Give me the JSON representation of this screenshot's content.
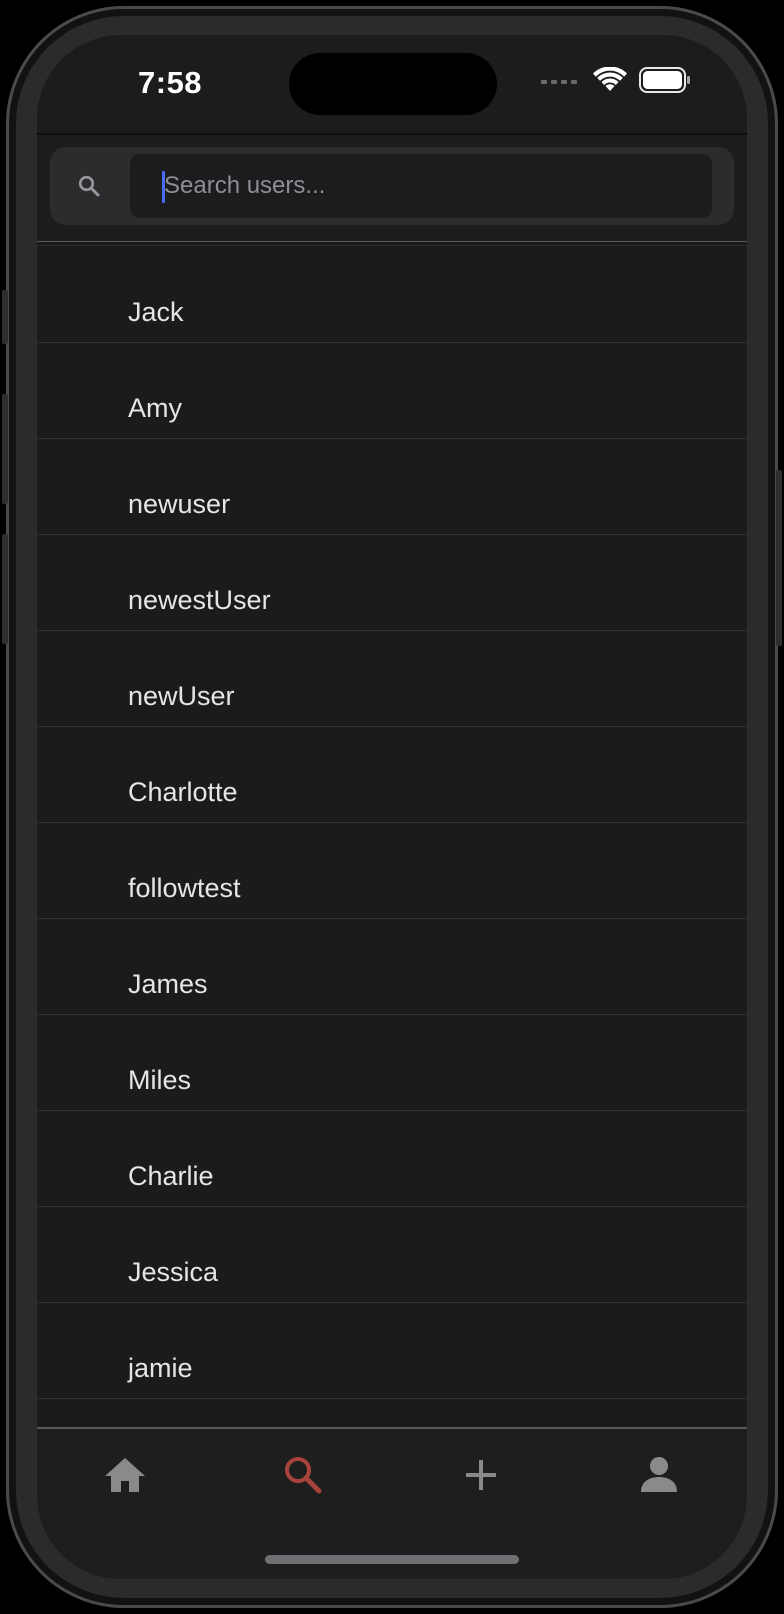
{
  "status_bar": {
    "time": "7:58",
    "wifi_icon": "wifi-icon",
    "battery_icon": "battery-icon"
  },
  "search": {
    "placeholder": "Search users...",
    "value": "",
    "icon": "search-icon"
  },
  "users": [
    {
      "name": "Jack"
    },
    {
      "name": "Amy"
    },
    {
      "name": "newuser"
    },
    {
      "name": "newestUser"
    },
    {
      "name": "newUser"
    },
    {
      "name": "Charlotte"
    },
    {
      "name": "followtest"
    },
    {
      "name": "James"
    },
    {
      "name": "Miles"
    },
    {
      "name": "Charlie"
    },
    {
      "name": "Jessica"
    },
    {
      "name": "jamie"
    }
  ],
  "tab_bar": {
    "tabs": [
      {
        "id": "home",
        "icon": "home-icon",
        "active": false
      },
      {
        "id": "search",
        "icon": "search-icon",
        "active": true
      },
      {
        "id": "add",
        "icon": "plus-icon",
        "active": false
      },
      {
        "id": "profile",
        "icon": "person-icon",
        "active": false
      }
    ],
    "active_color": "#a8423c",
    "inactive_color": "#8a8a8d"
  },
  "colors": {
    "background": "#1b1b1b",
    "text": "#e5e5e5",
    "caret": "#4a6cf7"
  }
}
